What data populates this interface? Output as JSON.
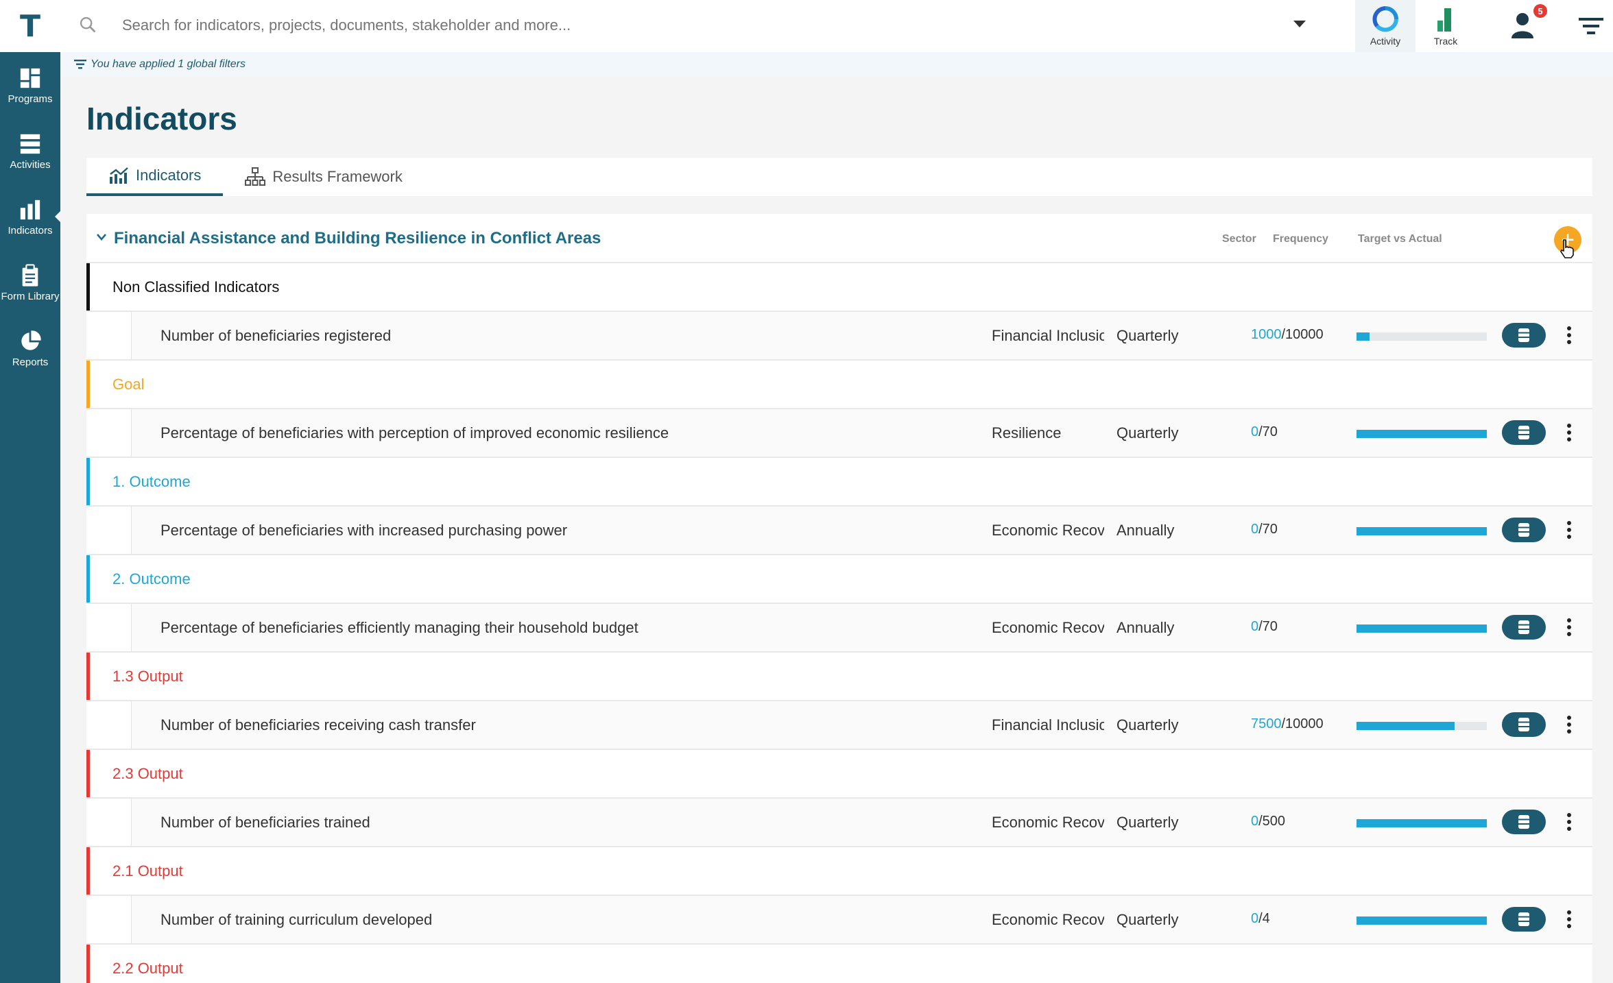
{
  "sidebar": {
    "logo": "T",
    "items": [
      {
        "label": "Programs",
        "icon": "dashboard-icon"
      },
      {
        "label": "Activities",
        "icon": "server-stack-icon"
      },
      {
        "label": "Indicators",
        "icon": "bar-chart-icon",
        "active": true
      },
      {
        "label": "Form Library",
        "icon": "clipboard-icon"
      },
      {
        "label": "Reports",
        "icon": "pie-chart-icon"
      }
    ]
  },
  "topbar": {
    "search_placeholder": "Search for indicators, projects, documents, stakeholder and more...",
    "activity_label": "Activity",
    "track_label": "Track",
    "notification_count": "5"
  },
  "filter_note": "You have applied 1 global filters",
  "page_title": "Indicators",
  "tabs": [
    {
      "label": "Indicators",
      "active": true
    },
    {
      "label": "Results Framework",
      "active": false
    }
  ],
  "card": {
    "title": "Financial Assistance and Building Resilience in Conflict Areas",
    "columns": {
      "sector": "Sector",
      "frequency": "Frequency",
      "target_vs_actual": "Target vs Actual"
    },
    "rows": [
      {
        "type": "group",
        "title": "Non Classified Indicators",
        "color": "#111111"
      },
      {
        "type": "indicator",
        "name": "Number of beneficiaries registered",
        "sector": "Financial Inclusion",
        "frequency": "Quarterly",
        "actual": "1000",
        "target": "/10000",
        "progress": 0.1
      },
      {
        "type": "group",
        "title": "Goal",
        "color": "#f5a623"
      },
      {
        "type": "indicator",
        "name": "Percentage of beneficiaries with perception of improved economic resilience",
        "sector": "Resilience",
        "frequency": "Quarterly",
        "actual": "0",
        "target": "/70",
        "progress": 1.0
      },
      {
        "type": "group",
        "title": "1. Outcome",
        "color": "#1ea7d6"
      },
      {
        "type": "indicator",
        "name": "Percentage of beneficiaries with increased purchasing power",
        "sector": "Economic Recovery",
        "frequency": "Annually",
        "actual": "0",
        "target": "/70",
        "progress": 1.0
      },
      {
        "type": "group",
        "title": "2. Outcome",
        "color": "#1ea7d6"
      },
      {
        "type": "indicator",
        "name": "Percentage of beneficiaries efficiently managing their household budget",
        "sector": "Economic Recovery",
        "frequency": "Annually",
        "actual": "0",
        "target": "/70",
        "progress": 1.0
      },
      {
        "type": "group",
        "title": "1.3 Output",
        "color": "#e53935"
      },
      {
        "type": "indicator",
        "name": "Number of beneficiaries receiving cash transfer",
        "sector": "Financial Inclusion",
        "frequency": "Quarterly",
        "actual": "7500",
        "target": "/10000",
        "progress": 0.75
      },
      {
        "type": "group",
        "title": "2.3 Output",
        "color": "#e53935"
      },
      {
        "type": "indicator",
        "name": "Number of beneficiaries trained",
        "sector": "Economic Recovery",
        "frequency": "Quarterly",
        "actual": "0",
        "target": "/500",
        "progress": 1.0
      },
      {
        "type": "group",
        "title": "2.1 Output",
        "color": "#e53935"
      },
      {
        "type": "indicator",
        "name": "Number of training curriculum developed",
        "sector": "Economic Recovery",
        "frequency": "Quarterly",
        "actual": "0",
        "target": "/4",
        "progress": 1.0
      },
      {
        "type": "group",
        "title": "2.2 Output",
        "color": "#e53935"
      }
    ]
  },
  "colors": {
    "primary": "#1e5a70",
    "accent": "#1ea7d6",
    "add_button": "#f5a623"
  }
}
